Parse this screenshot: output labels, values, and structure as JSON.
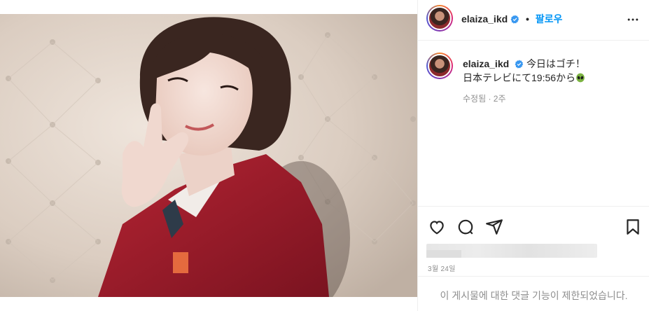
{
  "post": {
    "image_alt": "photo"
  },
  "header": {
    "username": "elaiza_ikd",
    "dot": "•",
    "follow_label": "팔로우",
    "more_icon": "more-horizontal-icon"
  },
  "caption": {
    "username": "elaiza_ikd",
    "line1": "今日はゴチ！",
    "line2": "日本テレビにて19:56から",
    "emoji": "alien-icon",
    "meta": "수정됨 · 2주"
  },
  "actions": {
    "like_icon": "heart-icon",
    "comment_icon": "comment-icon",
    "share_icon": "send-icon",
    "save_icon": "bookmark-icon",
    "date": "3월 24일"
  },
  "comments": {
    "disabled_text": "이 게시물에 대한 댓글 기능이 제한되었습니다."
  },
  "colors": {
    "accent": "#0095f6",
    "verified": "#3897f0",
    "muted": "#8e8e8e"
  }
}
